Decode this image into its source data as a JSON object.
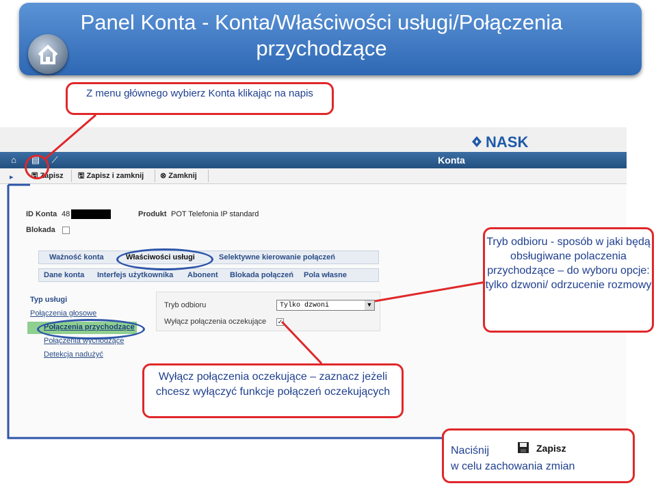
{
  "banner": {
    "title": "Panel Konta - Konta/Właściwości usługi/Połączenia przychodzące",
    "home_icon": "home-icon"
  },
  "callouts": {
    "menu": "Z menu głównego wybierz Konta klikając na napis",
    "tryb": "Tryb odbioru - sposób w jaki będą obsługiwane polaczenia przychodzące – do wyboru opcje: tylko dzwoni/ odrzucenie rozmowy",
    "wylacz": "Wyłącz połączenia oczekujące – zaznacz jeżeli chcesz wyłączyć funkcje połączeń oczekujących",
    "nacisnij_line1": "Naciśnij",
    "nacisnij_line2": "w celu zachowania zmian",
    "zapisz_label": "Zapisz"
  },
  "app": {
    "logo_text": "NASK",
    "nav_title": "Konta",
    "toolbar": {
      "save": "Zapisz",
      "save_close": "Zapisz i zamknij",
      "close": "Zamknij"
    },
    "account": {
      "id_label": "ID Konta",
      "id_value": "48",
      "product_label": "Produkt",
      "product_value": "POT Telefonia IP standard",
      "block_label": "Blokada"
    },
    "tabs_row1": [
      "Ważność konta",
      "Właściwości usługi",
      "Selektywne kierowanie połączeń"
    ],
    "tabs_row2": [
      "Dane konta",
      "Interfejs użytkownika",
      "Abonent",
      "Blokada połączeń",
      "Pola własne"
    ],
    "side": {
      "title": "Typ usługi",
      "links": [
        "Połączenia głosowe",
        "Połączenia przychodzące",
        "Połączenia wychodzące",
        "Detekcja nadużyć"
      ]
    },
    "form": {
      "tryb_label": "Tryb odbioru",
      "tryb_value": "Tylko dzwoni",
      "wylacz_label": "Wyłącz połączenia oczekujące",
      "wylacz_checked": true
    }
  },
  "colors": {
    "accent_red": "#e0272a",
    "banner_blue": "#2e68b4",
    "nav_blue": "#23507f"
  }
}
